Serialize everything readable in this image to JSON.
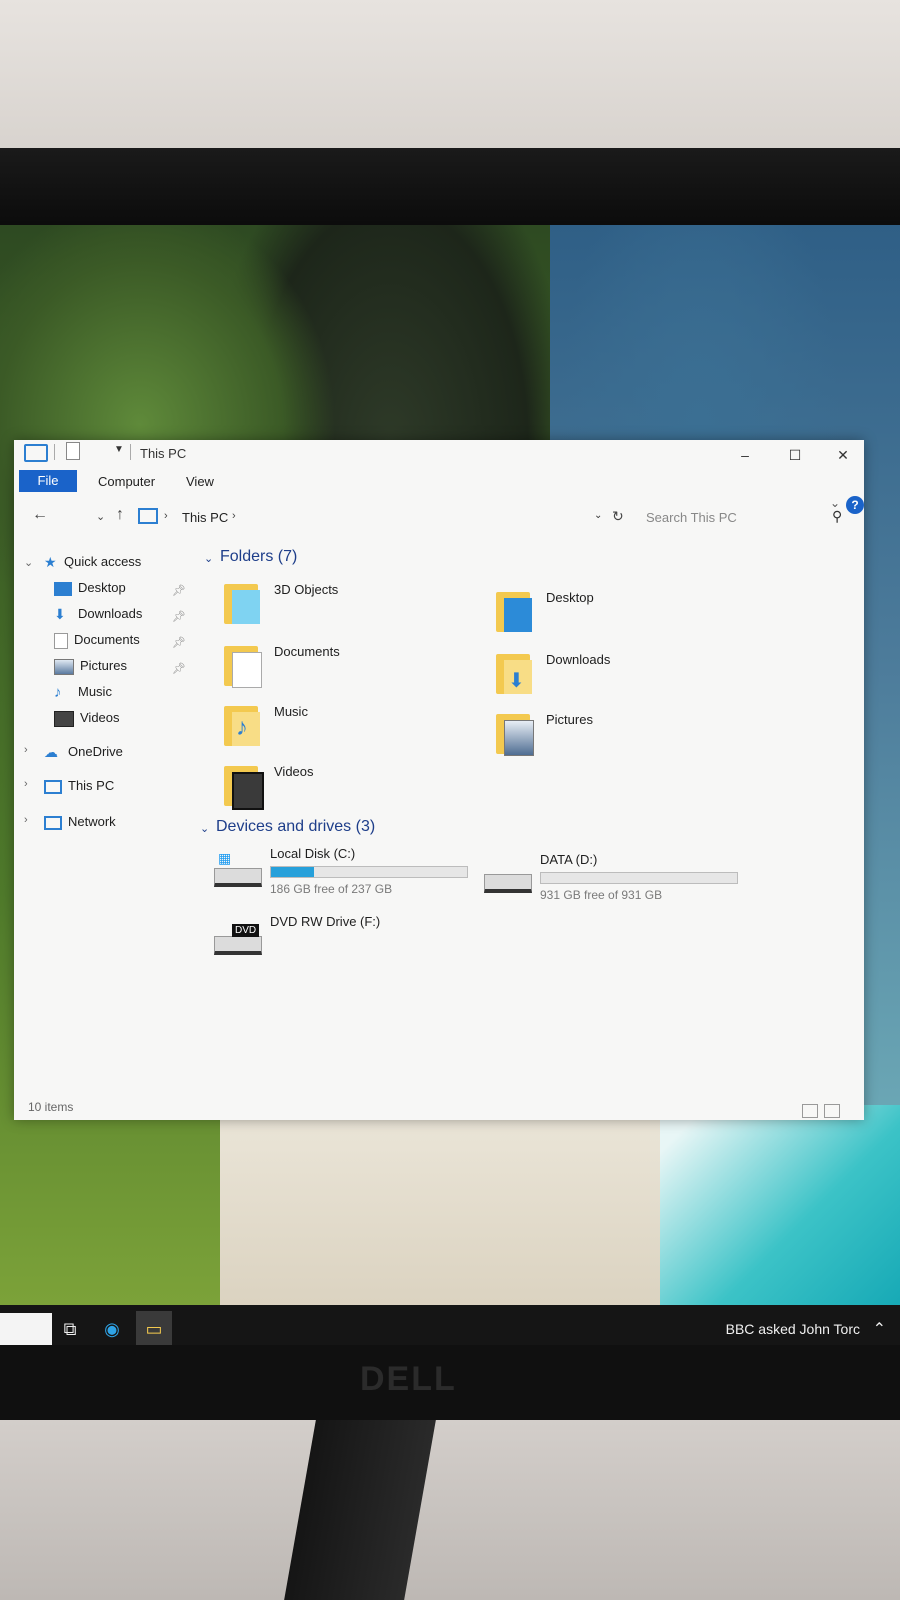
{
  "window": {
    "title": "This PC",
    "controls": {
      "minimize": "–",
      "maximize": "☐",
      "close": "✕"
    }
  },
  "ribbon": {
    "tabs": [
      "File",
      "Computer",
      "View"
    ],
    "help": "?"
  },
  "address": {
    "crumb": "This PC",
    "search_placeholder": "Search This PC"
  },
  "sidebar": {
    "quick_access": "Quick access",
    "pinned": [
      {
        "label": "Desktop",
        "pinned": true
      },
      {
        "label": "Downloads",
        "pinned": true
      },
      {
        "label": "Documents",
        "pinned": true
      },
      {
        "label": "Pictures",
        "pinned": true
      },
      {
        "label": "Music",
        "pinned": false
      },
      {
        "label": "Videos",
        "pinned": false
      }
    ],
    "roots": [
      "OneDrive",
      "This PC",
      "Network"
    ]
  },
  "folders_group": "Folders (7)",
  "folders": [
    "3D Objects",
    "Desktop",
    "Documents",
    "Downloads",
    "Music",
    "Pictures",
    "Videos"
  ],
  "devices_group": "Devices and drives (3)",
  "drives": [
    {
      "name": "Local Disk (C:)",
      "free": "186 GB free of 237 GB",
      "used_fraction": 0.22
    },
    {
      "name": "DATA (D:)",
      "free": "931 GB free of 931 GB",
      "used_fraction": 0.0
    },
    {
      "name": "DVD RW Drive (F:)",
      "badge": "DVD"
    }
  ],
  "status": {
    "items": "10 items"
  },
  "taskbar": {
    "news": "BBC asked John Torc"
  },
  "monitor_brand": "DELL",
  "colors": {
    "accent": "#1a63c9",
    "folder": "#f3c94f",
    "drive_bar": "#26a0da"
  }
}
